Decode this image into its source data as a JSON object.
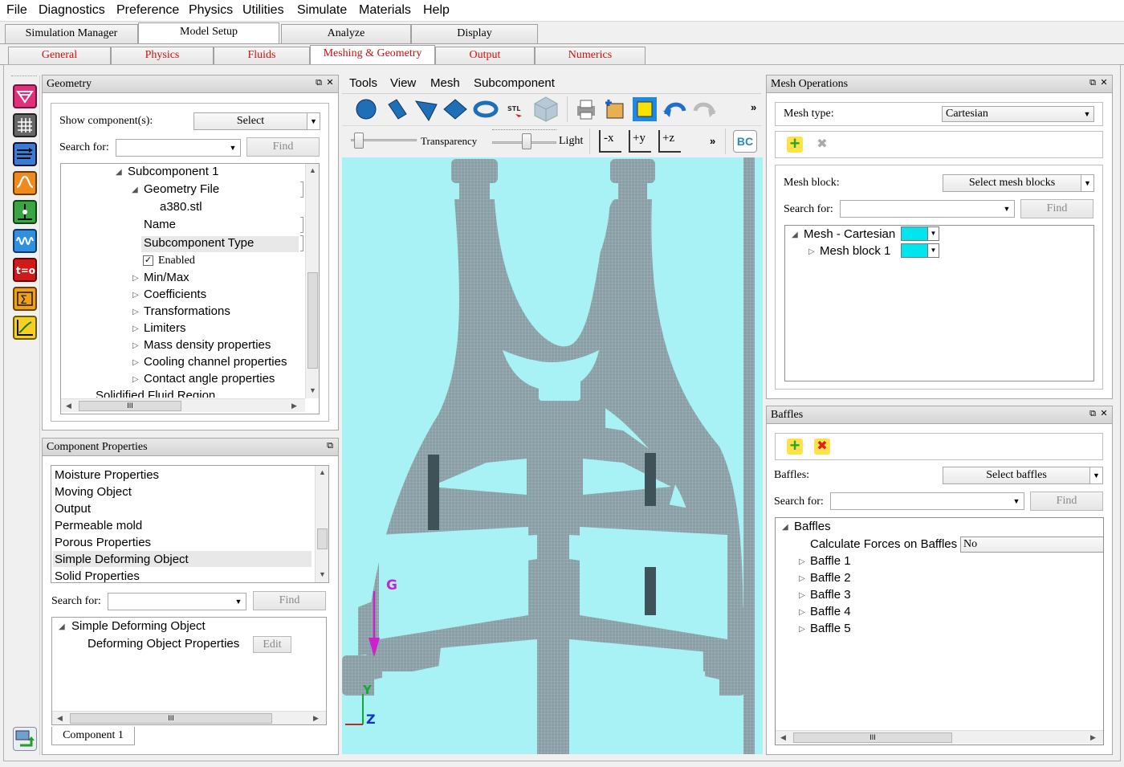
{
  "menu": [
    "File",
    "Diagnostics",
    "Preference",
    "Physics",
    "Utilities",
    "Simulate",
    "Materials",
    "Help"
  ],
  "main_tabs": [
    "Simulation Manager",
    "Model Setup",
    "Analyze",
    "Display"
  ],
  "sub_tabs": [
    "General",
    "Physics",
    "Fluids",
    "Meshing & Geometry",
    "Output",
    "Numerics"
  ],
  "geometry": {
    "title": "Geometry",
    "show_component_label": "Show component(s):",
    "show_component_value": "Select",
    "search_label": "Search for:",
    "find": "Find",
    "tree": {
      "subcomponent": "Subcomponent 1",
      "geometry_file": "Geometry File",
      "file_name": "a380.stl",
      "name": "Name",
      "subcomponent_type": "Subcomponent Type",
      "enabled": "Enabled",
      "items": [
        "Min/Max",
        "Coefficients",
        "Transformations",
        "Limiters",
        "Mass density properties",
        "Cooling channel properties",
        "Contact angle properties"
      ],
      "cut_item": "Solidified Fluid Region"
    }
  },
  "component_properties": {
    "title": "Component Properties",
    "list": [
      "Moisture Properties",
      "Moving Object",
      "Output",
      "Permeable mold",
      "Porous Properties",
      "Simple Deforming Object",
      "Solid Properties"
    ],
    "search_label": "Search for:",
    "find": "Find",
    "tree_root": "Simple Deforming Object",
    "tree_child": "Deforming Object Properties",
    "edit": "Edit",
    "bottom_tab": "Component 1"
  },
  "viewport": {
    "menu": [
      "Tools",
      "View",
      "Mesh",
      "Subcomponent"
    ],
    "transparency": "Transparency",
    "light": "Light",
    "axis_buttons": [
      "-x",
      "+y",
      "+z"
    ],
    "bc": "BC",
    "stl_label": "STL",
    "more": "»",
    "gravity_label": "G",
    "axis_y": "Y",
    "axis_z": "Z",
    "transparency_level": 0.05,
    "light_level": 0.55,
    "colors": {
      "background": "#a8f2f5",
      "solid": "#8fa0a6",
      "gravity": "#cc22cc"
    }
  },
  "mesh_operations": {
    "title": "Mesh Operations",
    "mesh_type_label": "Mesh type:",
    "mesh_type_value": "Cartesian",
    "mesh_block_label": "Mesh block:",
    "mesh_block_value": "Select  mesh blocks",
    "search_label": "Search for:",
    "find": "Find",
    "tree_root": "Mesh - Cartesian",
    "tree_child": "Mesh block 1",
    "swatch_color": "#00e5ee"
  },
  "baffles": {
    "title": "Baffles",
    "baffles_label": "Baffles:",
    "baffles_value": "Select  baffles",
    "search_label": "Search for:",
    "find": "Find",
    "tree_root": "Baffles",
    "calc_label": "Calculate Forces on Baffles",
    "calc_value": "No",
    "items": [
      "Baffle 1",
      "Baffle 2",
      "Baffle 3",
      "Baffle 4",
      "Baffle 5"
    ]
  },
  "sidebar_icons": [
    "contour-icon",
    "mesh-grid-icon",
    "flow-lines-icon",
    "wave-icon",
    "probe-icon",
    "spring-icon",
    "time-zero-icon",
    "summation-icon",
    "graph-icon"
  ],
  "scroll_grip": "III"
}
